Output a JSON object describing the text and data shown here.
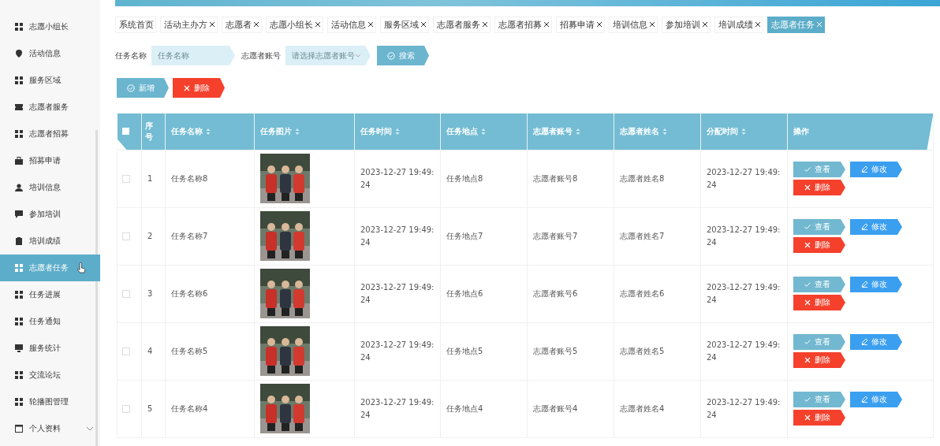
{
  "sidebar": {
    "items": [
      {
        "label": "志愿小组长",
        "kind": "grid",
        "selected": false
      },
      {
        "label": "活动信息",
        "kind": "pin",
        "selected": false
      },
      {
        "label": "服务区域",
        "kind": "grid",
        "selected": false
      },
      {
        "label": "志愿者服务",
        "kind": "ticket",
        "selected": false
      },
      {
        "label": "志愿者招募",
        "kind": "grid",
        "selected": false
      },
      {
        "label": "招募申请",
        "kind": "briefcase",
        "selected": false
      },
      {
        "label": "培训信息",
        "kind": "person",
        "selected": false
      },
      {
        "label": "参加培训",
        "kind": "chat",
        "selected": false
      },
      {
        "label": "培训成绩",
        "kind": "clipboard",
        "selected": false
      },
      {
        "label": "志愿者任务",
        "kind": "grid",
        "selected": true
      },
      {
        "label": "任务进展",
        "kind": "grid",
        "selected": false
      },
      {
        "label": "任务通知",
        "kind": "grid",
        "selected": false
      },
      {
        "label": "服务统计",
        "kind": "monitor",
        "selected": false
      },
      {
        "label": "交流论坛",
        "kind": "grid",
        "selected": false
      },
      {
        "label": "轮播图管理",
        "kind": "grid",
        "selected": false
      },
      {
        "label": "个人资料",
        "kind": "window",
        "selected": false,
        "expanded": false
      }
    ]
  },
  "tabs": [
    {
      "label": "系统首页",
      "closable": false,
      "selected": false
    },
    {
      "label": "活动主办方",
      "closable": true,
      "selected": false
    },
    {
      "label": "志愿者",
      "closable": true,
      "selected": false
    },
    {
      "label": "志愿小组长",
      "closable": true,
      "selected": false
    },
    {
      "label": "活动信息",
      "closable": true,
      "selected": false
    },
    {
      "label": "服务区域",
      "closable": true,
      "selected": false
    },
    {
      "label": "志愿者服务",
      "closable": true,
      "selected": false
    },
    {
      "label": "志愿者招募",
      "closable": true,
      "selected": false
    },
    {
      "label": "招募申请",
      "closable": true,
      "selected": false
    },
    {
      "label": "培训信息",
      "closable": true,
      "selected": false
    },
    {
      "label": "参加培训",
      "closable": true,
      "selected": false
    },
    {
      "label": "培训成绩",
      "closable": true,
      "selected": false
    },
    {
      "label": "志愿者任务",
      "closable": true,
      "selected": true
    }
  ],
  "search": {
    "fields": [
      {
        "label": "任务名称",
        "placeholder": "任务名称",
        "kind": "text"
      },
      {
        "label": "志愿者账号",
        "placeholder": "请选择志愿者账号",
        "kind": "select"
      }
    ],
    "button": "搜索"
  },
  "toolbar": [
    {
      "label": "新增",
      "kind": "add"
    },
    {
      "label": "删除",
      "kind": "delete"
    }
  ],
  "table": {
    "header_checkbox": {
      "checked": false
    },
    "columns": [
      {
        "label": "序号",
        "sortable": false
      },
      {
        "label": "任务名称",
        "sortable": true
      },
      {
        "label": "任务图片",
        "sortable": true
      },
      {
        "label": "任务时间",
        "sortable": true
      },
      {
        "label": "任务地点",
        "sortable": true
      },
      {
        "label": "志愿者账号",
        "sortable": true
      },
      {
        "label": "志愿者姓名",
        "sortable": true
      },
      {
        "label": "分配时间",
        "sortable": true
      },
      {
        "label": "操作",
        "sortable": false
      }
    ],
    "rows": [
      {
        "checked": false,
        "index": "1",
        "name": "任务名称8",
        "time": "2023-12-27 19:49:24",
        "place": "任务地点8",
        "account": "志愿者账号8",
        "volunteer": "志愿者姓名8",
        "assigned": "2023-12-27 19:49:24",
        "actions": [
          {
            "label": "查看",
            "kind": "view"
          },
          {
            "label": "修改",
            "kind": "edit"
          },
          {
            "label": "删除",
            "kind": "delete"
          }
        ]
      },
      {
        "checked": false,
        "index": "2",
        "name": "任务名称7",
        "time": "2023-12-27 19:49:24",
        "place": "任务地点7",
        "account": "志愿者账号7",
        "volunteer": "志愿者姓名7",
        "assigned": "2023-12-27 19:49:24",
        "actions": [
          {
            "label": "查看",
            "kind": "view"
          },
          {
            "label": "修改",
            "kind": "edit"
          },
          {
            "label": "删除",
            "kind": "delete"
          }
        ]
      },
      {
        "checked": false,
        "index": "3",
        "name": "任务名称6",
        "time": "2023-12-27 19:49:24",
        "place": "任务地点6",
        "account": "志愿者账号6",
        "volunteer": "志愿者姓名6",
        "assigned": "2023-12-27 19:49:24",
        "actions": [
          {
            "label": "查看",
            "kind": "view"
          },
          {
            "label": "修改",
            "kind": "edit"
          },
          {
            "label": "删除",
            "kind": "delete"
          }
        ]
      },
      {
        "checked": false,
        "index": "4",
        "name": "任务名称5",
        "time": "2023-12-27 19:49:24",
        "place": "任务地点5",
        "account": "志愿者账号5",
        "volunteer": "志愿者姓名5",
        "assigned": "2023-12-27 19:49:24",
        "actions": [
          {
            "label": "查看",
            "kind": "view"
          },
          {
            "label": "修改",
            "kind": "edit"
          },
          {
            "label": "删除",
            "kind": "delete"
          }
        ]
      },
      {
        "checked": false,
        "index": "5",
        "name": "任务名称4",
        "time": "2023-12-27 19:49:24",
        "place": "任务地点4",
        "account": "志愿者账号4",
        "volunteer": "志愿者姓名4",
        "assigned": "2023-12-27 19:49:24",
        "actions": [
          {
            "label": "查看",
            "kind": "view"
          },
          {
            "label": "修改",
            "kind": "edit"
          },
          {
            "label": "删除",
            "kind": "delete"
          }
        ]
      }
    ]
  }
}
